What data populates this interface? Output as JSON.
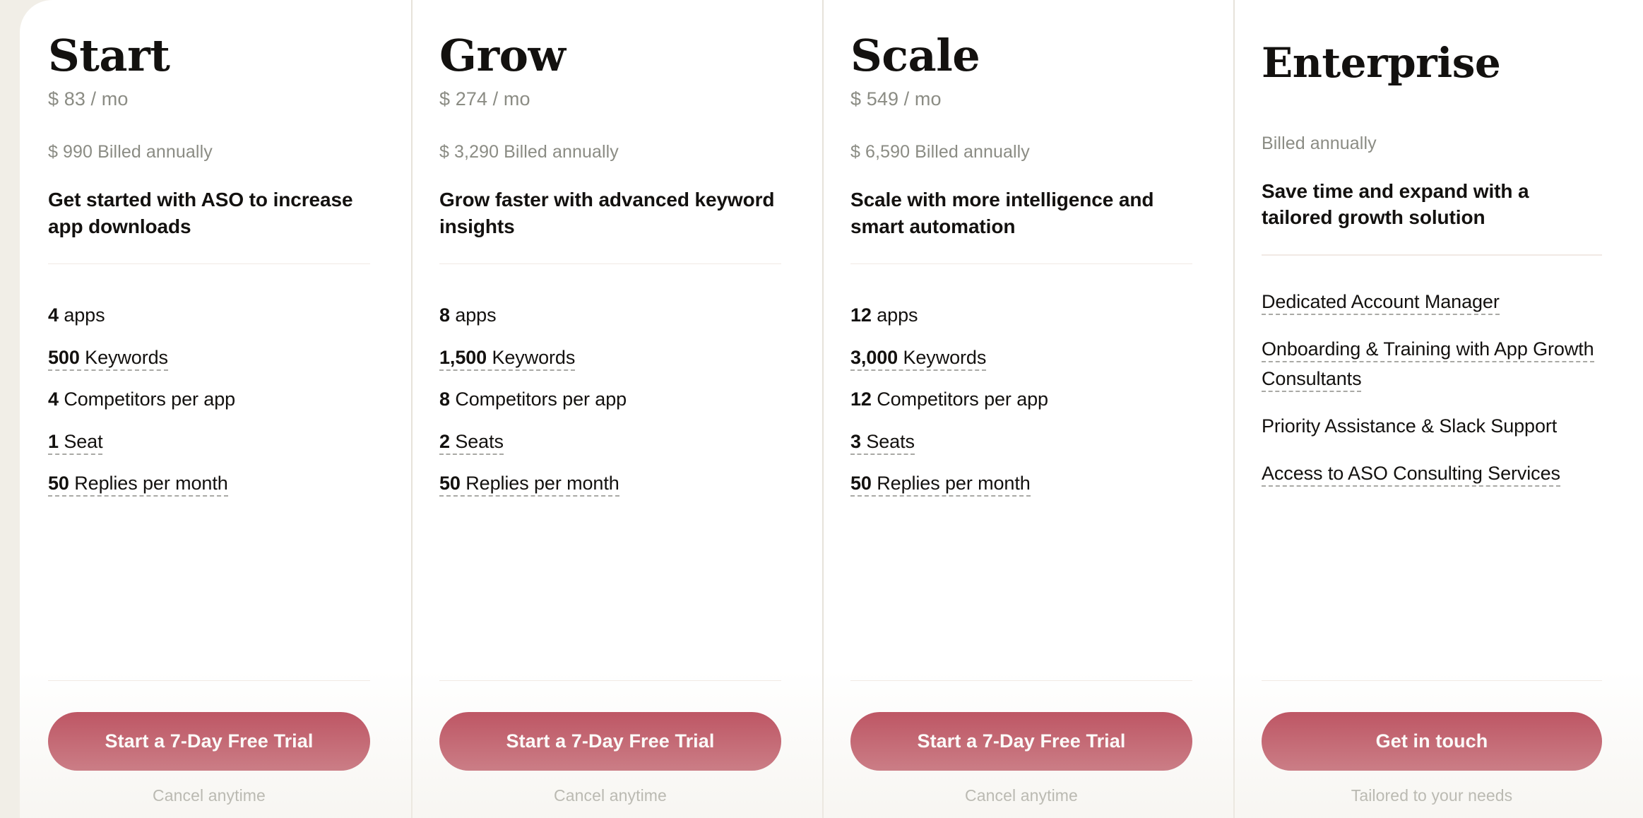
{
  "page": {
    "background_color": "#f1eee7",
    "card_background": "#ffffff",
    "accent_color": "#b43a4c",
    "muted_text_color": "#8b8c84",
    "divider_color": "#e6e2da"
  },
  "plans": [
    {
      "id": "start",
      "title": "Start",
      "price": "$ 83 / mo",
      "billing": "$ 990 Billed annually",
      "tagline": "Get started with ASO to increase app downloads",
      "features": [
        {
          "qty": "4",
          "label": "apps",
          "dashed": false
        },
        {
          "qty": "500",
          "label": "Keywords",
          "dashed": true
        },
        {
          "qty": "4",
          "label": "Competitors per app",
          "dashed": false
        },
        {
          "qty": "1",
          "label": "Seat",
          "dashed": true
        },
        {
          "qty": "50",
          "label": "Replies per month",
          "dashed": true
        }
      ],
      "cta_label": "Start a 7-Day Free Trial",
      "cta_note": "Cancel anytime"
    },
    {
      "id": "grow",
      "title": "Grow",
      "price": "$ 274 / mo",
      "billing": "$ 3,290 Billed annually",
      "tagline": "Grow faster with advanced keyword insights",
      "features": [
        {
          "qty": "8",
          "label": "apps",
          "dashed": false
        },
        {
          "qty": "1,500",
          "label": "Keywords",
          "dashed": true
        },
        {
          "qty": "8",
          "label": "Competitors per app",
          "dashed": false
        },
        {
          "qty": "2",
          "label": "Seats",
          "dashed": true
        },
        {
          "qty": "50",
          "label": "Replies per month",
          "dashed": true
        }
      ],
      "cta_label": "Start a 7-Day Free Trial",
      "cta_note": "Cancel anytime"
    },
    {
      "id": "scale",
      "title": "Scale",
      "price": "$ 549 / mo",
      "billing": "$ 6,590 Billed annually",
      "tagline": "Scale with more intelligence and smart automation",
      "features": [
        {
          "qty": "12",
          "label": "apps",
          "dashed": false
        },
        {
          "qty": "3,000",
          "label": "Keywords",
          "dashed": true
        },
        {
          "qty": "12",
          "label": "Competitors per app",
          "dashed": false
        },
        {
          "qty": "3",
          "label": "Seats",
          "dashed": true
        },
        {
          "qty": "50",
          "label": "Replies per month",
          "dashed": true
        }
      ],
      "cta_label": "Start a 7-Day Free Trial",
      "cta_note": "Cancel anytime"
    },
    {
      "id": "enterprise",
      "title": "Enterprise",
      "price": "",
      "billing": "Billed annually",
      "tagline": "Save time and expand with a tailored growth solution",
      "features": [
        {
          "qty": "",
          "label": "Dedicated Account Manager",
          "dashed": true
        },
        {
          "qty": "",
          "label": "Onboarding & Training with App Growth Consultants",
          "dashed": true
        },
        {
          "qty": "",
          "label": "Priority Assistance & Slack Support",
          "dashed": false
        },
        {
          "qty": "",
          "label": "Access to ASO Consulting Services",
          "dashed": true
        }
      ],
      "cta_label": "Get in touch",
      "cta_note": "Tailored to your needs"
    }
  ]
}
